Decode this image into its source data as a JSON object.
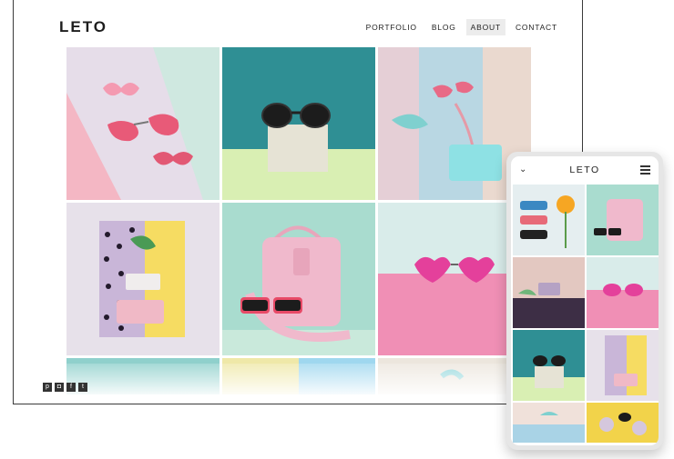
{
  "site": {
    "logo": "LETO",
    "nav": [
      {
        "label": "PORTFOLIO"
      },
      {
        "label": "BLOG"
      },
      {
        "label": "ABOUT",
        "active": true
      },
      {
        "label": "CONTACT"
      }
    ]
  },
  "social": [
    {
      "icon": "pinterest-icon",
      "glyph": "p"
    },
    {
      "icon": "instagram-icon",
      "glyph": "◘"
    },
    {
      "icon": "facebook-icon",
      "glyph": "f"
    },
    {
      "icon": "twitter-icon",
      "glyph": "t"
    }
  ],
  "mobile": {
    "title": "LETO"
  },
  "colors": {
    "pink": "#f2b6c8",
    "teal": "#2f8f94",
    "mint": "#b9e2d6",
    "lavender": "#e3dae8",
    "yellow": "#f6dc62"
  }
}
